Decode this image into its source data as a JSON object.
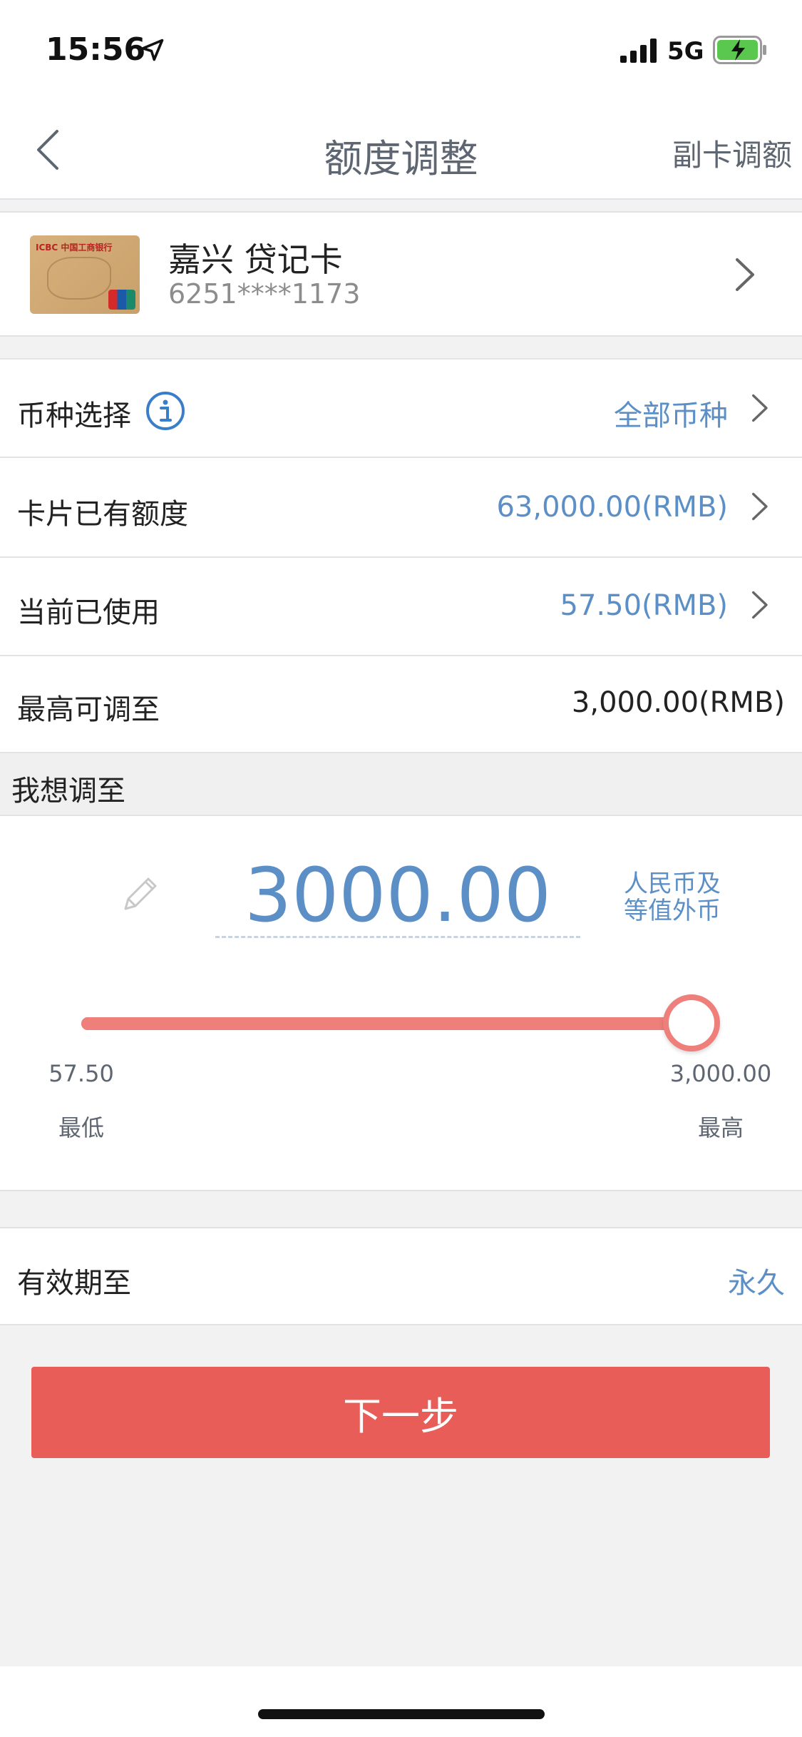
{
  "status_bar": {
    "time": "15:56",
    "network": "5G",
    "icons": [
      "location-arrow-icon",
      "signal-icon",
      "battery-charging-icon"
    ]
  },
  "nav": {
    "title": "额度调整",
    "right_action": "副卡调额",
    "back_icon": "chevron-left-icon"
  },
  "card": {
    "name": "嘉兴 贷记卡",
    "number": "6251****1173",
    "image_brand": "ICBC 中国工商银行"
  },
  "rows": {
    "currency": {
      "label": "币种选择",
      "value": "全部币种"
    },
    "existing_limit": {
      "label": "卡片已有额度",
      "value": "63,000.00(RMB)"
    },
    "used": {
      "label": "当前已使用",
      "value": "57.50(RMB)"
    },
    "max_adjust": {
      "label": "最高可调至",
      "value": "3,000.00(RMB)"
    }
  },
  "adjust": {
    "section_label": "我想调至",
    "amount": "3000.00",
    "currency_note_line1": "人民币及",
    "currency_note_line2": "等值外币",
    "slider": {
      "min": 57.5,
      "max": 3000,
      "value": 3000
    },
    "min_value": "57.50",
    "max_value": "3,000.00",
    "min_label": "最低",
    "max_label": "最高"
  },
  "expire": {
    "label": "有效期至",
    "value": "永久"
  },
  "next_button_label": "下一步",
  "colors": {
    "accent_blue": "#5b8fc6",
    "button_red": "#e85d58",
    "slider_red": "#ee7f7a"
  }
}
